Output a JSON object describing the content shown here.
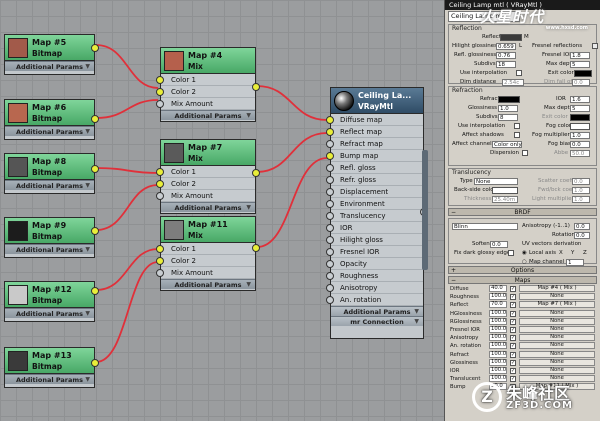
{
  "colors": {
    "accent_socket": "#e9ee3a",
    "wire": "#e0303a",
    "map_node_header": "#5bbf7a",
    "vray_node_header": "#3d5a75"
  },
  "maps": [
    {
      "title": "Map #5",
      "type": "Bitmap",
      "footer": "Additional Params",
      "thumb": "#a25a4a"
    },
    {
      "title": "Map #6",
      "type": "Bitmap",
      "footer": "Additional Params",
      "thumb": "#b8674f"
    },
    {
      "title": "Map #8",
      "type": "Bitmap",
      "footer": "Additional Params",
      "thumb": "#555555"
    },
    {
      "title": "Map #9",
      "type": "Bitmap",
      "footer": "Additional Params",
      "thumb": "#1c1c1c"
    },
    {
      "title": "Map #12",
      "type": "Bitmap",
      "footer": "Additional Params",
      "thumb": "#c9c9c9"
    },
    {
      "title": "Map #13",
      "type": "Bitmap",
      "footer": "Additional Params",
      "thumb": "#3a3a3a"
    }
  ],
  "mixes": [
    {
      "title": "Map #4",
      "type": "Mix",
      "thumb": "#b5604c",
      "inputs": [
        "Color 1",
        "Color 2",
        "Mix Amount"
      ],
      "footer": "Additional Params"
    },
    {
      "title": "Map #7",
      "type": "Mix",
      "thumb": "#5a5a5a",
      "inputs": [
        "Color 1",
        "Color 2",
        "Mix Amount"
      ],
      "footer": "Additional Params"
    },
    {
      "title": "Map #11",
      "type": "Mix",
      "thumb": "#7d7d7d",
      "inputs": [
        "Color 1",
        "Color 2",
        "Mix Amount"
      ],
      "footer": "Additional Params"
    }
  ],
  "material": {
    "title": "Ceiling La...",
    "type": "VRayMtl",
    "slots": [
      "Diffuse map",
      "Reflect map",
      "Refract map",
      "Bump map",
      "Refl. gloss",
      "Refr. gloss",
      "Displacement",
      "Environment",
      "Translucency",
      "IOR",
      "Hilight gloss",
      "Fresnel IOR",
      "Opacity",
      "Roughness",
      "Anisotropy",
      "An. rotation"
    ],
    "footer1": "Additional Params",
    "footer2": "mr Connection"
  },
  "panel": {
    "titlebar": "Ceiling Lamp mtl  ( VRayMtl )",
    "name": "Ceiling Lamp mtl",
    "reflection": {
      "caption": "Reflection",
      "reflect": "Reflect",
      "m": "M",
      "hilight": "Hilight glossiness",
      "hilight_v": "0.659",
      "l": "L",
      "fresnel": "Fresnel reflections",
      "refl_gloss": "Refl. glossiness",
      "refl_gloss_v": "0.76",
      "fresnel_ior": "Fresnel IOR",
      "fresnel_ior_v": "1.8",
      "subdivs": "Subdivs",
      "subdivs_v": "18",
      "maxdepth": "Max depth",
      "maxdepth_v": "5",
      "use_interp": "Use interpolation",
      "exit_color": "Exit color",
      "dim_distance": "Dim distance",
      "dim_distance_v": "2.54c",
      "dim_falloff": "Dim fall off",
      "dim_falloff_v": "0.0"
    },
    "refraction": {
      "caption": "Refraction",
      "refract": "Refract",
      "ior": "IOR",
      "ior_v": "1.6",
      "glossiness": "Glossiness",
      "glossiness_v": "1.0",
      "maxdepth": "Max depth",
      "maxdepth_v": "5",
      "subdivs": "Subdivs",
      "subdivs_v": "8",
      "exit_color": "Exit color",
      "use_interp": "Use interpolation",
      "fog_color": "Fog color",
      "affect_shadows": "Affect shadows",
      "fog_mult": "Fog multiplier",
      "fog_mult_v": "1.0",
      "affect_channels": "Affect channels",
      "affect_channels_v": "Color only",
      "fog_bias": "Fog bias",
      "fog_bias_v": "0.0",
      "dispersion": "Dispersion",
      "abbe": "Abbe",
      "abbe_v": "50.0"
    },
    "translucency": {
      "caption": "Translucency",
      "type": "Type",
      "type_v": "None",
      "scatter": "Scatter coeff",
      "scatter_v": "0.0",
      "backside": "Back-side color",
      "fwd": "Fwd/bck coeff",
      "fwd_v": "1.0",
      "thickness": "Thickness",
      "thickness_v": "25.40m",
      "light_mult": "Light multiplier",
      "light_mult_v": "1.0"
    },
    "brdf": {
      "rollout": "BRDF",
      "type_v": "Blinn",
      "anisotropy": "Anisotropy (-1..1)",
      "anisotropy_v": "0.0",
      "rotation": "Rotation",
      "rotation_v": "0.0",
      "soften": "Soften",
      "soften_v": "0.0",
      "uv_caption": "UV vectors derivation",
      "fix_dark": "Fix dark glossy edges",
      "local_axis": "Local axis",
      "x": "X",
      "y": "Y",
      "z": "Z",
      "map_channel": "Map channel",
      "map_channel_v": "1"
    },
    "options_rollout": "Options",
    "maps_rollout": "Maps",
    "maps": [
      {
        "name": "Diffuse",
        "value": "40.0",
        "map": "Map #4  ( Mix )"
      },
      {
        "name": "Roughness",
        "value": "100.0",
        "map": "None"
      },
      {
        "name": "Reflect",
        "value": "70.0",
        "map": "Map #7  ( Mix )"
      },
      {
        "name": "HGlossiness",
        "value": "100.0",
        "map": "None"
      },
      {
        "name": "RGlossiness",
        "value": "100.0",
        "map": "None"
      },
      {
        "name": "Fresnel IOR",
        "value": "100.0",
        "map": "None"
      },
      {
        "name": "Anisotropy",
        "value": "100.0",
        "map": "None"
      },
      {
        "name": "An. rotation",
        "value": "100.0",
        "map": "None"
      },
      {
        "name": "Refract",
        "value": "100.0",
        "map": "None"
      },
      {
        "name": "Glossiness",
        "value": "100.0",
        "map": "None"
      },
      {
        "name": "IOR",
        "value": "100.0",
        "map": "None"
      },
      {
        "name": "Translucent",
        "value": "100.0",
        "map": "None"
      },
      {
        "name": "Bump",
        "value": "30.0",
        "map": "Map #11  ( Mix )"
      }
    ]
  },
  "watermark_top": {
    "text": "火星时代",
    "sub": "www.hxsd.com"
  },
  "watermark_bottom": {
    "text": "朱峰社区",
    "url": "ZF3D.COM"
  }
}
